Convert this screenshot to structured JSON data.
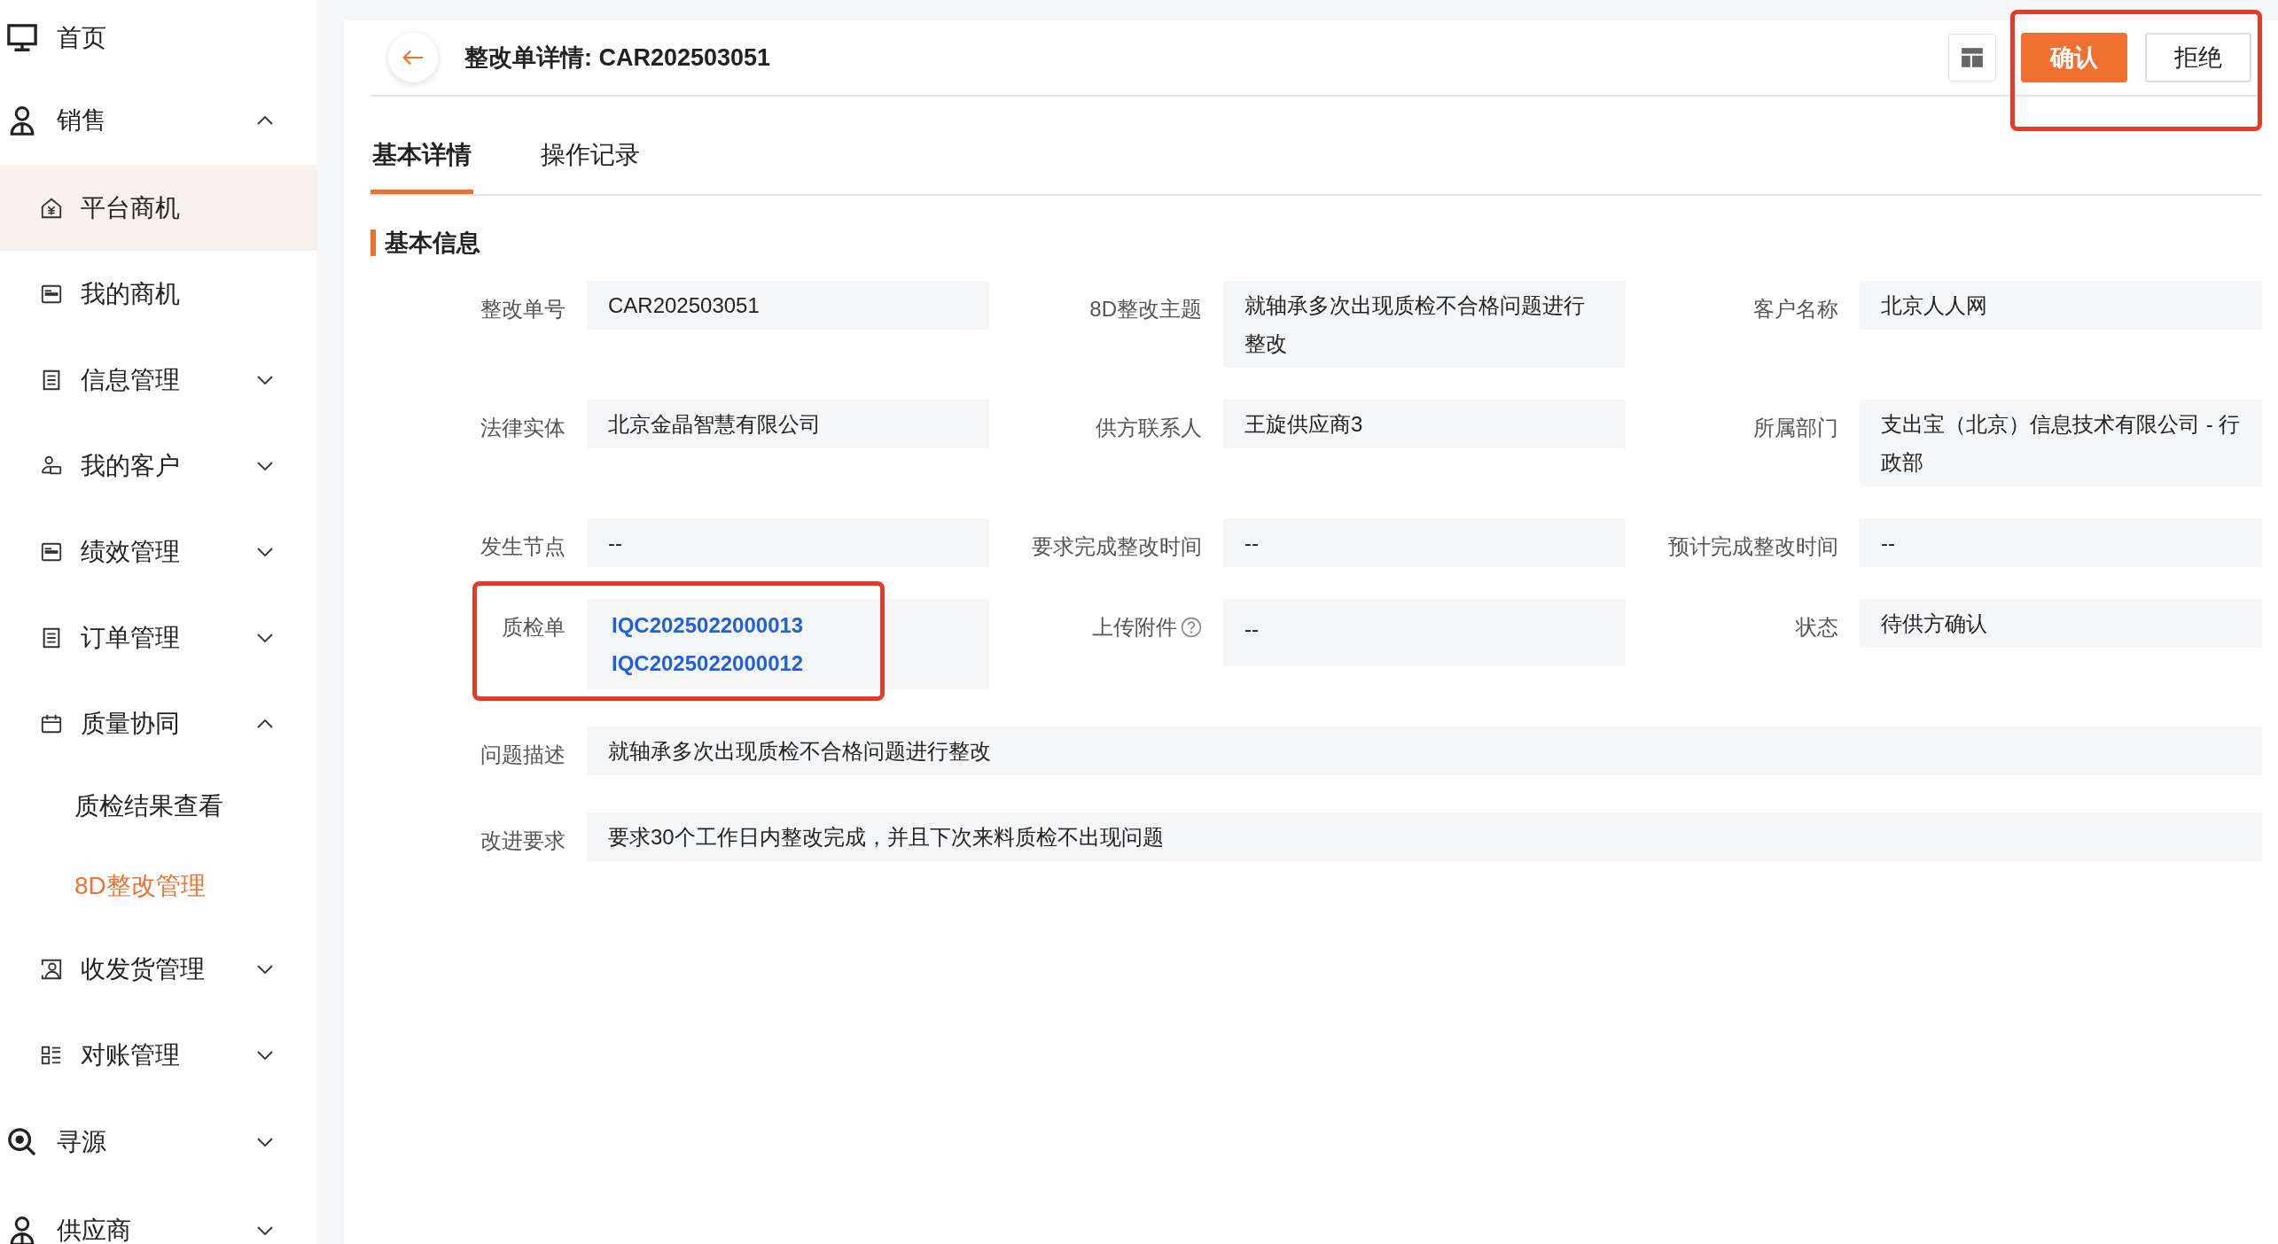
{
  "sidebar": {
    "items": [
      {
        "label": "首页",
        "kind": "link",
        "selected": false,
        "hovered": false
      },
      {
        "label": "销售",
        "kind": "group",
        "expanded": true,
        "children": [
          {
            "label": "平台商机",
            "kind": "link",
            "selected": false,
            "hovered": true
          },
          {
            "label": "我的商机",
            "kind": "link",
            "selected": false,
            "hovered": false
          },
          {
            "label": "信息管理",
            "kind": "group",
            "expanded": false
          },
          {
            "label": "我的客户",
            "kind": "group",
            "expanded": false
          },
          {
            "label": "绩效管理",
            "kind": "group",
            "expanded": false
          },
          {
            "label": "订单管理",
            "kind": "group",
            "expanded": false
          },
          {
            "label": "质量协同",
            "kind": "group",
            "expanded": true,
            "children": [
              {
                "label": "质检结果查看",
                "kind": "link",
                "selected": false,
                "hovered": false
              },
              {
                "label": "8D整改管理",
                "kind": "link",
                "selected": true,
                "hovered": false
              }
            ]
          },
          {
            "label": "收发货管理",
            "kind": "group",
            "expanded": false
          },
          {
            "label": "对账管理",
            "kind": "group",
            "expanded": false
          }
        ]
      },
      {
        "label": "寻源",
        "kind": "group",
        "expanded": false
      },
      {
        "label": "供应商",
        "kind": "group",
        "expanded": false
      }
    ]
  },
  "header": {
    "title": "整改单详情: CAR202503051",
    "actions_highlighted": true,
    "actions": [
      {
        "label": "确认",
        "kind": "primary"
      },
      {
        "label": "拒绝",
        "kind": "default"
      }
    ]
  },
  "tabs": [
    {
      "label": "基本详情",
      "selected": true
    },
    {
      "label": "操作记录",
      "selected": false
    }
  ],
  "section": {
    "title": "基本信息"
  },
  "fields": [
    {
      "label": "整改单号",
      "kind": "text",
      "value": "CAR202503051"
    },
    {
      "label": "8D整改主题",
      "kind": "text",
      "value": "就轴承多次出现质检不合格问题进行整改"
    },
    {
      "label": "客户名称",
      "kind": "text",
      "value": "北京人人网"
    },
    {
      "label": "法律实体",
      "kind": "text",
      "value": "北京金晶智慧有限公司"
    },
    {
      "label": "供方联系人",
      "kind": "text",
      "value": "王旋供应商3"
    },
    {
      "label": "所属部门",
      "kind": "text",
      "value": "支出宝（北京）信息技术有限公司 - 行政部"
    },
    {
      "label": "发生节点",
      "kind": "text",
      "value": "--"
    },
    {
      "label": "要求完成整改时间",
      "kind": "text",
      "value": "--"
    },
    {
      "label": "预计完成整改时间",
      "kind": "text",
      "value": "--"
    },
    {
      "label": "质检单",
      "kind": "links",
      "highlighted": true,
      "links": [
        "IQC2025022000013",
        "IQC2025022000012"
      ]
    },
    {
      "label": "上传附件",
      "kind": "text",
      "help": true,
      "value": "--"
    },
    {
      "label": "状态",
      "kind": "text",
      "value": "待供方确认"
    }
  ],
  "wide_fields": [
    {
      "label": "问题描述",
      "value": "就轴承多次出现质检不合格问题进行整改"
    },
    {
      "label": "改进要求",
      "value": "要求30个工作日内整改完成，并且下次来料质检不出现问题"
    }
  ]
}
